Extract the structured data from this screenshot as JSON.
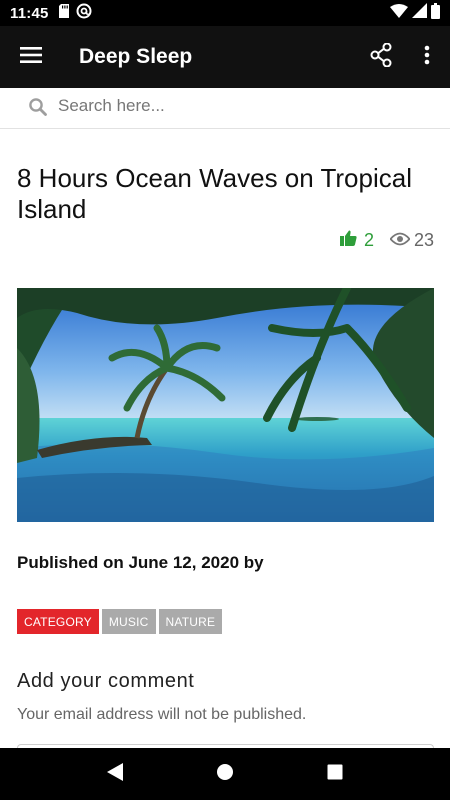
{
  "status_bar": {
    "time": "11:45",
    "left_icons": [
      "sd-card-icon",
      "vpn-at-icon"
    ],
    "right_icons": [
      "wifi-icon",
      "cell-signal-icon",
      "battery-icon"
    ]
  },
  "app_bar": {
    "menu_icon": "hamburger-menu-icon",
    "title": "Deep Sleep",
    "actions": [
      "share-icon",
      "more-vertical-icon"
    ]
  },
  "search": {
    "placeholder": "Search here..."
  },
  "post": {
    "title": "8 Hours Ocean Waves on Tropical Island",
    "likes": "2",
    "views": "23",
    "published": "Published on June 12, 2020 by",
    "tags": [
      "CATEGORY",
      "MUSIC",
      "NATURE"
    ]
  },
  "comments": {
    "title": "Add your comment",
    "note": "Your email address will not be published."
  },
  "colors": {
    "app_bar": "#111111",
    "like_green": "#2e9e3a",
    "category_red": "#e3262b",
    "tag_grey": "#aaaaaa"
  },
  "nav_bar": {
    "buttons": [
      "back-icon",
      "home-icon",
      "recents-icon"
    ]
  }
}
